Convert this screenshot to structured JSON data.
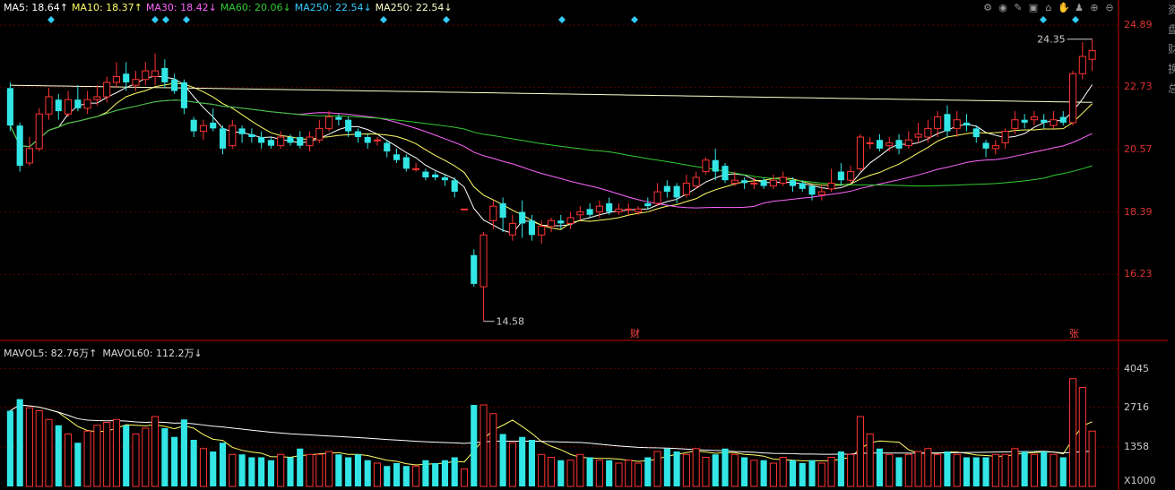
{
  "legend": [
    {
      "label": "MA5: 18.64",
      "arrow": "↑",
      "color": "#ffffff"
    },
    {
      "label": "MA10: 18.37",
      "arrow": "↑",
      "color": "#ffff66"
    },
    {
      "label": "MA30: 18.42",
      "arrow": "↓",
      "color": "#ff66ff"
    },
    {
      "label": "MA60: 20.06",
      "arrow": "↓",
      "color": "#33cc33"
    },
    {
      "label": "MA250: 22.54",
      "arrow": "↓",
      "color": "#33ccff"
    },
    {
      "label": "MA250: 22.54",
      "arrow": "↓",
      "color": "#ffffcc"
    }
  ],
  "volume_legend": [
    {
      "label": "MAVOL5: 82.76万",
      "arrow": "↑"
    },
    {
      "label": "MAVOL60: 112.2万",
      "arrow": "↓"
    }
  ],
  "toolbar_icons": [
    "settings-icon",
    "eye-icon",
    "pen-icon",
    "basket-icon",
    "home-icon",
    "hand-icon",
    "bell-icon",
    "zoom-in-icon",
    "zoom-out-icon"
  ],
  "toolbar_glyphs": [
    "⚙",
    "◉",
    "✎",
    "▣",
    "⌂",
    "✋",
    "♟",
    "⊕",
    "⊖"
  ],
  "price_axis": [
    "24.89",
    "22.73",
    "20.57",
    "18.39",
    "16.23"
  ],
  "volume_axis": [
    "4045",
    "2716",
    "1358",
    "X1000"
  ],
  "annotations": {
    "high": "24.35",
    "low": "14.58",
    "marker_cai": "财",
    "marker_zhang": "张"
  },
  "right_strip": [
    "资",
    "盘",
    "财",
    "换",
    "总"
  ],
  "colors": {
    "up": "#ff3333",
    "down": "#33e6e6",
    "grid": "#5a0000",
    "ma5": "#ffffff",
    "ma10": "#ffff66",
    "ma30": "#ff66ff",
    "ma60": "#33cc33",
    "ma250": "#ffffcc",
    "marker": "#33ccff"
  },
  "chart_data": {
    "type": "candlestick",
    "price_range": [
      14.0,
      25.2
    ],
    "volume_range": [
      0,
      4400
    ],
    "candles": [
      [
        22.7,
        21.4,
        22.9,
        21.2,
        2600
      ],
      [
        21.4,
        20.0,
        21.5,
        19.8,
        3000
      ],
      [
        20.1,
        20.6,
        21.0,
        20.0,
        2700
      ],
      [
        20.6,
        21.8,
        22.0,
        20.5,
        2600
      ],
      [
        21.8,
        22.4,
        22.7,
        21.6,
        2300
      ],
      [
        22.3,
        21.9,
        22.5,
        21.6,
        2100
      ],
      [
        21.8,
        22.3,
        22.6,
        21.7,
        1800
      ],
      [
        22.3,
        22.0,
        22.8,
        21.9,
        1500
      ],
      [
        22.0,
        22.3,
        22.6,
        21.8,
        1900
      ],
      [
        22.3,
        22.4,
        22.8,
        22.1,
        2100
      ],
      [
        22.4,
        22.9,
        23.1,
        22.2,
        2200
      ],
      [
        22.9,
        23.1,
        23.6,
        22.7,
        2300
      ],
      [
        23.2,
        22.9,
        23.6,
        22.6,
        2100
      ],
      [
        22.8,
        23.0,
        23.3,
        22.6,
        1800
      ],
      [
        23.0,
        23.3,
        23.6,
        22.8,
        2000
      ],
      [
        23.1,
        23.3,
        23.9,
        22.8,
        2400
      ],
      [
        23.4,
        22.9,
        23.7,
        22.7,
        2000
      ],
      [
        23.0,
        22.6,
        23.2,
        22.5,
        1700
      ],
      [
        22.9,
        22.0,
        23.0,
        21.8,
        2300
      ],
      [
        21.6,
        21.2,
        21.7,
        21.0,
        1600
      ],
      [
        21.2,
        21.4,
        21.6,
        20.9,
        1300
      ],
      [
        21.5,
        21.3,
        22.0,
        21.2,
        1200
      ],
      [
        21.3,
        20.6,
        21.4,
        20.4,
        1500
      ],
      [
        20.7,
        21.4,
        21.6,
        20.6,
        1100
      ],
      [
        21.3,
        21.1,
        21.4,
        20.8,
        1100
      ],
      [
        21.1,
        21.0,
        21.3,
        20.8,
        1000
      ],
      [
        21.0,
        20.8,
        21.2,
        20.6,
        1000
      ],
      [
        20.9,
        20.7,
        21.0,
        20.6,
        900
      ],
      [
        20.7,
        21.0,
        21.2,
        20.6,
        1100
      ],
      [
        21.0,
        20.8,
        21.1,
        20.7,
        1000
      ],
      [
        21.0,
        20.7,
        21.2,
        20.6,
        1300
      ],
      [
        20.7,
        21.0,
        21.2,
        20.5,
        1100
      ],
      [
        20.9,
        21.3,
        21.6,
        20.8,
        1100
      ],
      [
        21.3,
        21.7,
        21.9,
        21.2,
        1200
      ],
      [
        21.7,
        21.6,
        21.8,
        21.4,
        1100
      ],
      [
        21.6,
        21.2,
        21.7,
        21.0,
        1000
      ],
      [
        21.2,
        21.0,
        21.3,
        20.8,
        1100
      ],
      [
        21.0,
        20.8,
        21.1,
        20.6,
        900
      ],
      [
        20.9,
        20.9,
        21.0,
        20.7,
        800
      ],
      [
        20.8,
        20.5,
        20.9,
        20.3,
        700
      ],
      [
        20.4,
        20.2,
        20.6,
        20.1,
        800
      ],
      [
        20.3,
        19.9,
        20.4,
        19.8,
        700
      ],
      [
        19.9,
        19.9,
        20.1,
        19.8,
        700
      ],
      [
        19.8,
        19.6,
        19.9,
        19.5,
        900
      ],
      [
        19.7,
        19.6,
        19.8,
        19.5,
        800
      ],
      [
        19.6,
        19.5,
        19.7,
        19.3,
        900
      ],
      [
        19.5,
        19.1,
        19.6,
        18.9,
        1000
      ],
      [
        18.5,
        18.5,
        18.5,
        18.5,
        600
      ],
      [
        16.9,
        15.9,
        17.1,
        15.8,
        2800
      ],
      [
        15.8,
        17.6,
        17.7,
        14.6,
        2800
      ],
      [
        18.1,
        18.6,
        18.8,
        17.8,
        2500
      ],
      [
        18.7,
        18.2,
        18.9,
        17.7,
        1800
      ],
      [
        17.6,
        18.0,
        18.3,
        17.4,
        1500
      ],
      [
        18.4,
        18.0,
        18.8,
        17.5,
        1700
      ],
      [
        18.1,
        17.6,
        18.3,
        17.4,
        1600
      ],
      [
        17.6,
        17.9,
        18.1,
        17.3,
        1100
      ],
      [
        17.9,
        18.1,
        18.2,
        17.7,
        1000
      ],
      [
        18.1,
        18.0,
        18.3,
        17.8,
        900
      ],
      [
        18.0,
        18.2,
        18.4,
        17.8,
        900
      ],
      [
        18.3,
        18.4,
        18.6,
        18.1,
        1100
      ],
      [
        18.5,
        18.3,
        18.7,
        18.2,
        1000
      ],
      [
        18.4,
        18.6,
        18.8,
        18.2,
        900
      ],
      [
        18.7,
        18.4,
        18.9,
        18.3,
        900
      ],
      [
        18.4,
        18.5,
        18.7,
        18.3,
        800
      ],
      [
        18.5,
        18.5,
        18.7,
        18.3,
        900
      ],
      [
        18.4,
        18.5,
        18.6,
        18.3,
        800
      ],
      [
        18.7,
        18.6,
        18.9,
        18.5,
        1000
      ],
      [
        18.7,
        19.1,
        19.4,
        18.6,
        1200
      ],
      [
        19.3,
        19.1,
        19.5,
        18.9,
        1300
      ],
      [
        19.3,
        18.9,
        19.4,
        18.7,
        1200
      ],
      [
        19.0,
        19.4,
        19.7,
        18.9,
        1100
      ],
      [
        19.3,
        19.6,
        19.8,
        19.2,
        1300
      ],
      [
        19.8,
        20.2,
        20.3,
        19.7,
        1000
      ],
      [
        20.2,
        19.8,
        20.6,
        19.5,
        1100
      ],
      [
        20.0,
        19.5,
        20.1,
        19.4,
        1300
      ],
      [
        19.4,
        19.5,
        19.8,
        19.3,
        1100
      ],
      [
        19.5,
        19.4,
        19.6,
        19.2,
        1000
      ],
      [
        19.4,
        19.4,
        19.6,
        19.2,
        900
      ],
      [
        19.5,
        19.3,
        19.6,
        19.2,
        900
      ],
      [
        19.3,
        19.5,
        19.7,
        19.2,
        800
      ],
      [
        19.4,
        19.6,
        19.8,
        19.3,
        1000
      ],
      [
        19.5,
        19.3,
        19.6,
        19.1,
        900
      ],
      [
        19.4,
        19.2,
        19.5,
        19.1,
        800
      ],
      [
        19.3,
        19.0,
        19.3,
        18.8,
        900
      ],
      [
        19.0,
        19.1,
        19.3,
        18.8,
        800
      ],
      [
        19.2,
        19.4,
        19.9,
        19.1,
        1000
      ],
      [
        19.8,
        19.5,
        20.1,
        19.3,
        1200
      ],
      [
        19.5,
        19.8,
        20.0,
        19.4,
        1100
      ],
      [
        19.9,
        21.0,
        21.1,
        19.8,
        2400
      ],
      [
        20.8,
        20.8,
        21.0,
        20.6,
        1800
      ],
      [
        20.9,
        20.6,
        21.1,
        20.5,
        1300
      ],
      [
        20.7,
        20.8,
        21.0,
        20.5,
        1100
      ],
      [
        20.9,
        20.6,
        21.1,
        20.4,
        1000
      ],
      [
        20.7,
        20.9,
        21.2,
        20.6,
        1100
      ],
      [
        21.0,
        21.1,
        21.5,
        20.8,
        1200
      ],
      [
        21.0,
        21.3,
        21.6,
        20.8,
        1300
      ],
      [
        21.3,
        21.7,
        21.9,
        21.0,
        1100
      ],
      [
        21.8,
        21.2,
        22.1,
        21.0,
        1200
      ],
      [
        21.3,
        21.6,
        21.9,
        21.0,
        1100
      ],
      [
        21.5,
        21.4,
        21.8,
        21.2,
        1000
      ],
      [
        21.3,
        21.0,
        21.4,
        20.8,
        1000
      ],
      [
        20.8,
        20.6,
        20.9,
        20.3,
        1000
      ],
      [
        20.6,
        20.7,
        20.9,
        20.4,
        1100
      ],
      [
        20.8,
        21.2,
        21.3,
        20.6,
        1100
      ],
      [
        21.3,
        21.6,
        21.9,
        21.1,
        1300
      ],
      [
        21.6,
        21.5,
        21.8,
        21.3,
        1200
      ],
      [
        21.6,
        21.7,
        21.9,
        21.4,
        1100
      ],
      [
        21.6,
        21.5,
        21.8,
        21.3,
        1200
      ],
      [
        21.4,
        21.6,
        21.9,
        21.3,
        1100
      ],
      [
        21.7,
        21.5,
        21.9,
        21.4,
        1000
      ],
      [
        21.5,
        23.2,
        23.3,
        21.4,
        3700
      ],
      [
        23.2,
        23.8,
        24.3,
        23.0,
        3400
      ],
      [
        23.7,
        24.0,
        24.4,
        23.3,
        1900
      ]
    ]
  }
}
